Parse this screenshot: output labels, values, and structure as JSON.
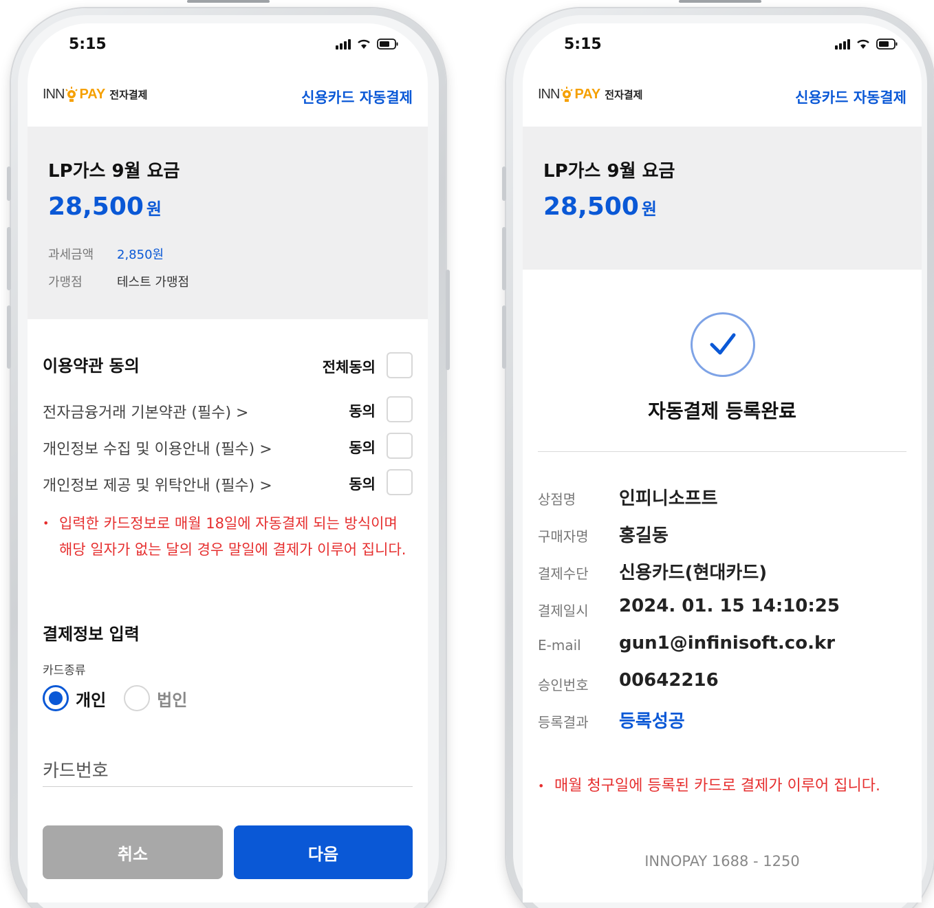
{
  "status": {
    "time": "5:15"
  },
  "brand": {
    "inn": "INN",
    "pay": "PAY",
    "sub": "전자결제",
    "header_link": "신용카드 자동결제"
  },
  "order": {
    "title": "LP가스 9월 요금",
    "amount": "28,500",
    "currency": "원"
  },
  "left": {
    "tax_label": "과세금액",
    "tax_value": "2,850원",
    "merchant_label": "가맹점",
    "merchant_value": "테스트 가맹점",
    "terms_title": "이용약관 동의",
    "agree_all": "전체동의",
    "terms": [
      {
        "label": "전자금융거래 기본약관 (필수)  >",
        "agree": "동의"
      },
      {
        "label": "개인정보 수집 및 이용안내 (필수)  >",
        "agree": "동의"
      },
      {
        "label": "개인정보 제공 및 위탁안내 (필수)  >",
        "agree": "동의"
      }
    ],
    "notice": "입력한 카드정보로 매월 18일에 자동결제 되는 방식이며 해당 일자가 없는 달의 경우 말일에 결제가 이루어 집니다.",
    "pay_title": "결제정보 입력",
    "card_type_label": "카드종류",
    "card_type_personal": "개인",
    "card_type_corp": "법인",
    "card_number_placeholder": "카드번호",
    "cancel": "취소",
    "next": "다음"
  },
  "right": {
    "done_title": "자동결제 등록완료",
    "rows": [
      {
        "k": "상점명",
        "v": "인피니소프트"
      },
      {
        "k": "구매자명",
        "v": "홍길동"
      },
      {
        "k": "결제수단",
        "v": "신용카드(현대카드)"
      },
      {
        "k": "결제일시",
        "v": "2024. 01. 15 14:10:25"
      },
      {
        "k": "E-mail",
        "v": "gun1@infinisoft.co.kr"
      },
      {
        "k": "승인번호",
        "v": "00642216"
      },
      {
        "k": "등록결과",
        "v": "등록성공"
      }
    ],
    "notice": "매월 청구일에 등록된 카드로 결제가 이루어 집니다.",
    "footer": "INNOPAY 1688 - 1250"
  },
  "colors": {
    "accent": "#0a58d6",
    "warning": "#e62e2e",
    "brand_orange": "#f5a000"
  },
  "icons": [
    "signal-icon",
    "wifi-icon",
    "battery-icon",
    "bulb-logo-icon",
    "check-icon",
    "chevron-right-icon"
  ]
}
